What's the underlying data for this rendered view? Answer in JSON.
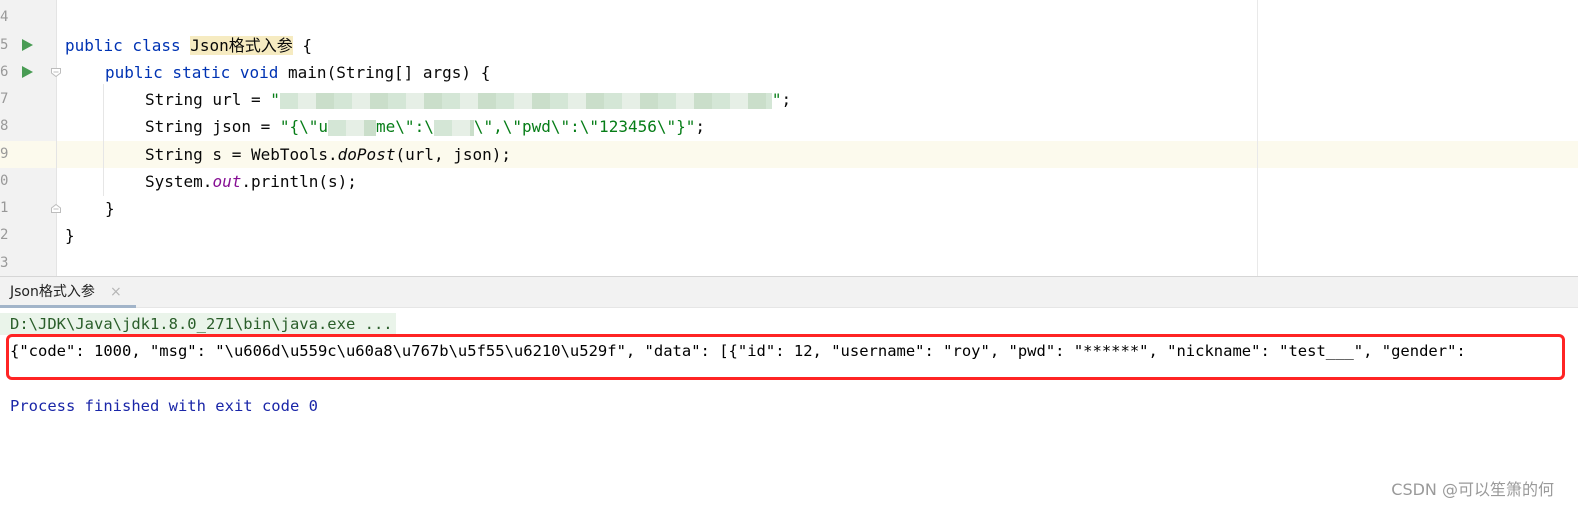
{
  "editor": {
    "line_numbers": [
      "4",
      "5",
      "6",
      "7",
      "8",
      "9",
      "0",
      "1",
      "2",
      "3"
    ],
    "lines": {
      "l5": {
        "kw": "public class ",
        "class_name": "Json格式入参",
        "rest": " {"
      },
      "l6": {
        "kw": "public static void ",
        "rest": "main(String[] args) {"
      },
      "l7": {
        "prefix": "String url = ",
        "str_open": "\"",
        "str_close": "\"",
        "end": ";"
      },
      "l8": {
        "prefix": "String json = ",
        "str_a": "\"{\\\"u",
        "str_b": "me\\\":\\",
        "str_c": "\\\",\\\"pwd\\\":\\\"123456\\\"}\"",
        "end": ";"
      },
      "l9": {
        "prefix": "String s = WebTools.",
        "method": "doPost",
        "rest": "(url, json);"
      },
      "l10": {
        "prefix": "System.",
        "field": "out",
        "rest": ".println(s);"
      },
      "l11": {
        "text": "}"
      },
      "l12": {
        "text": "}"
      }
    },
    "colors": {
      "keyword": "#0033b3",
      "string": "#067d17",
      "field": "#871094",
      "run_icon": "#499c54"
    }
  },
  "run_panel": {
    "tab_label": "Json格式入参",
    "tab_close": "×",
    "command_line": "D:\\JDK\\Java\\jdk1.8.0_271\\bin\\java.exe ...",
    "output_line": "{\"code\": 1000, \"msg\": \"\\u606d\\u559c\\u60a8\\u767b\\u5f55\\u6210\\u529f\", \"data\": [{\"id\": 12, \"username\": \"roy\", \"pwd\": \"******\", \"nickname\": \"test___\", \"gender\":",
    "exit_message": "Process finished with exit code 0",
    "highlight_color": "#ff2424"
  },
  "watermark": "CSDN @可以笙箫的何"
}
